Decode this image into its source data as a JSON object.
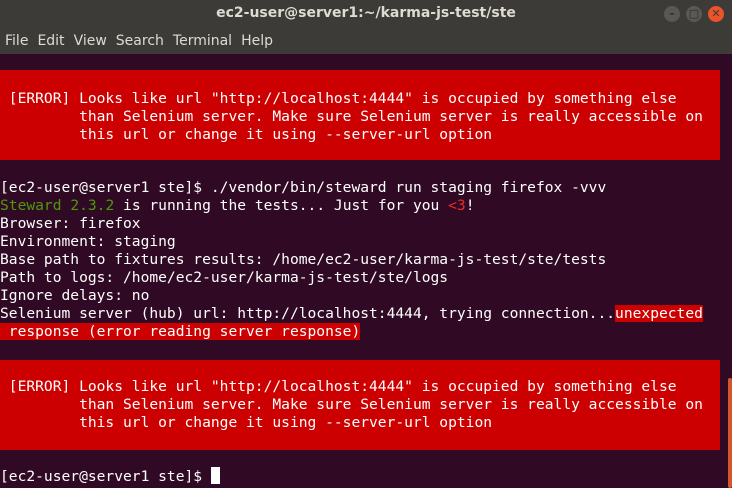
{
  "window": {
    "title": "ec2-user@server1:~/karma-js-test/ste",
    "min_btn": "–",
    "max_btn": "□",
    "close_btn": "✕"
  },
  "menu": [
    "File",
    "Edit",
    "View",
    "Search",
    "Terminal",
    "Help"
  ],
  "terminal": {
    "error1": {
      "line1": " [ERROR] Looks like url \"http://localhost:4444\" is occupied by something else",
      "line2": "         than Selenium server. Make sure Selenium server is really accessible on",
      "line3": "         this url or change it using --server-url option"
    },
    "prompt1": "[ec2-user@server1 ste]$ ./vendor/bin/steward run staging firefox -vvv",
    "steward_line": {
      "name": "Steward",
      "version": "2.3.2",
      "mid": " is running the tests... Just for you ",
      "heart": "<3",
      "end": "!"
    },
    "browser": "Browser: firefox",
    "environment": "Environment: staging",
    "fixtures": "Base path to fixtures results: /home/ec2-user/karma-js-test/ste/tests",
    "logs": "Path to logs: /home/ec2-user/karma-js-test/ste/logs",
    "delays": "Ignore delays: no",
    "selenium": {
      "text": "Selenium server (hub) url: http://localhost:4444, trying connection...",
      "error_part1": "unexpected",
      "error_part2": " response (error reading server response)"
    },
    "error2": {
      "line1": " [ERROR] Looks like url \"http://localhost:4444\" is occupied by something else",
      "line2": "         than Selenium server. Make sure Selenium server is really accessible on",
      "line3": "         this url or change it using --server-url option"
    },
    "prompt2": "[ec2-user@server1 ste]$ "
  },
  "colors": {
    "background": "#300a24",
    "error_bg": "#cc0000",
    "green": "#4e9a06"
  }
}
